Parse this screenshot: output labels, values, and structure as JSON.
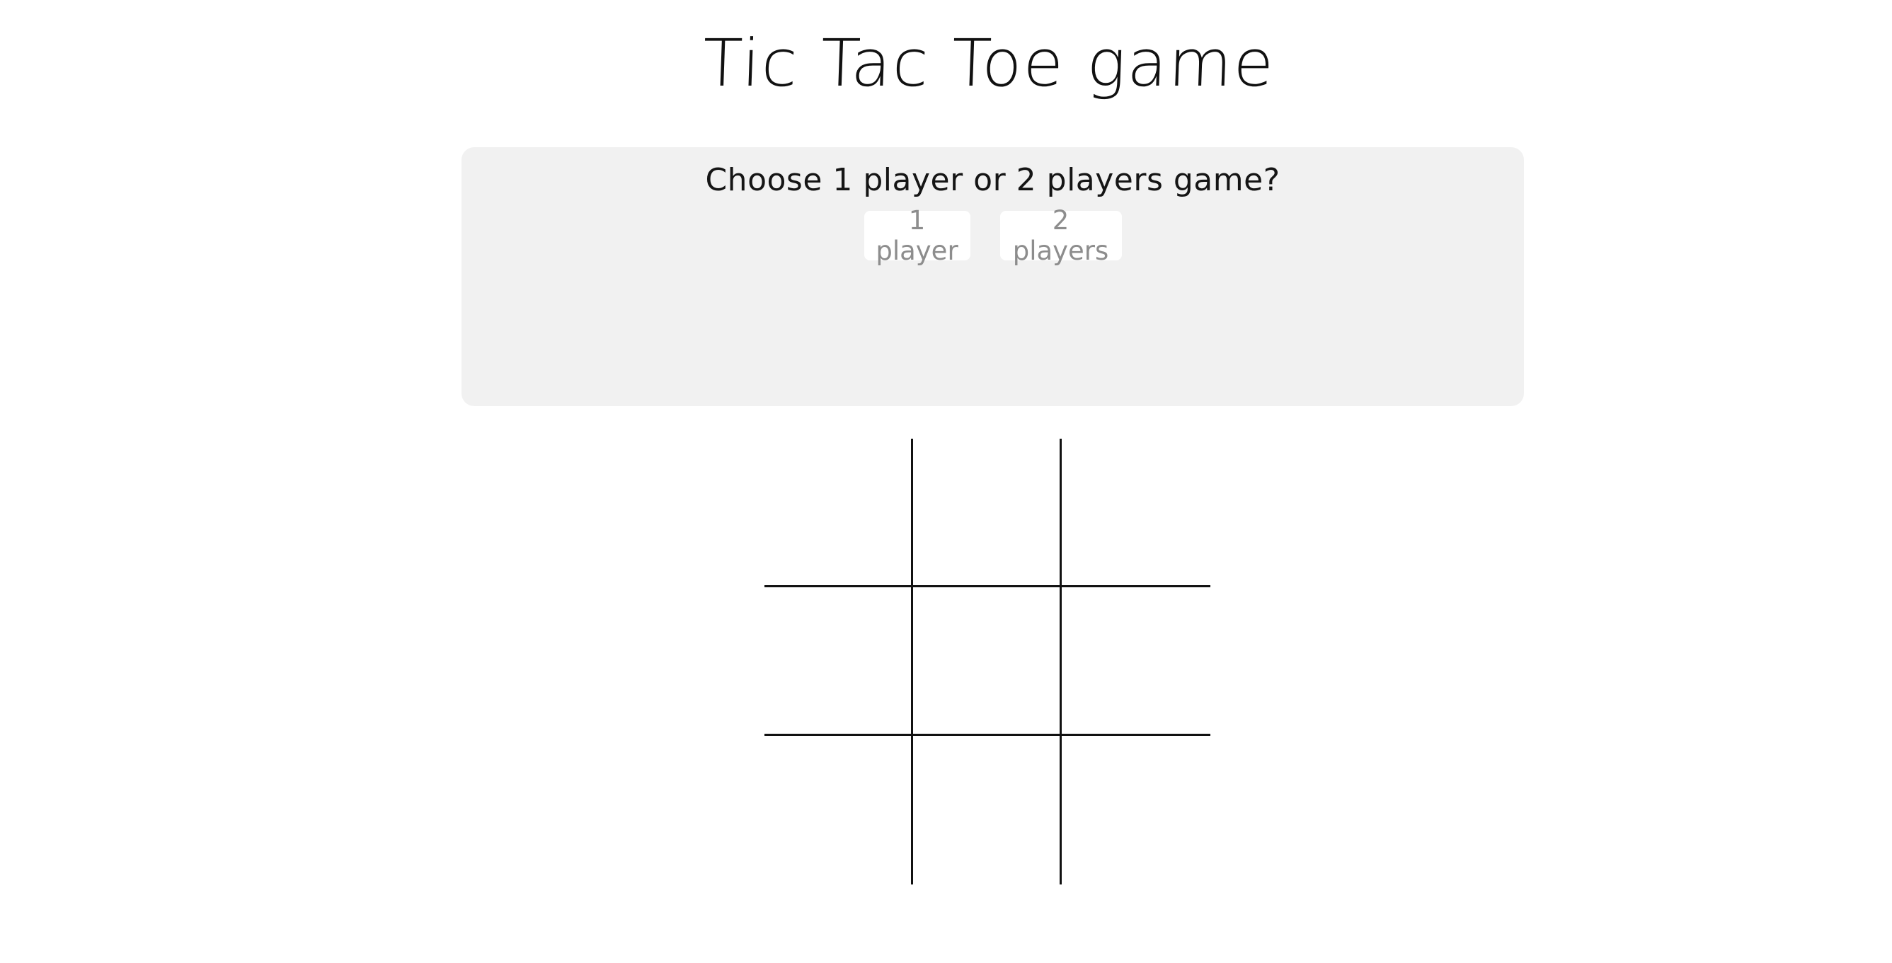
{
  "header": {
    "title": "Tic Tac Toe game"
  },
  "setup_panel": {
    "prompt": "Choose 1 player or 2 players game?",
    "one_player_label": "1 player",
    "two_players_label": "2 players",
    "background": "#f1f1f1"
  },
  "board": {
    "cells": [
      "",
      "",
      "",
      "",
      "",
      "",
      "",
      "",
      ""
    ],
    "line_color": "#111111"
  }
}
